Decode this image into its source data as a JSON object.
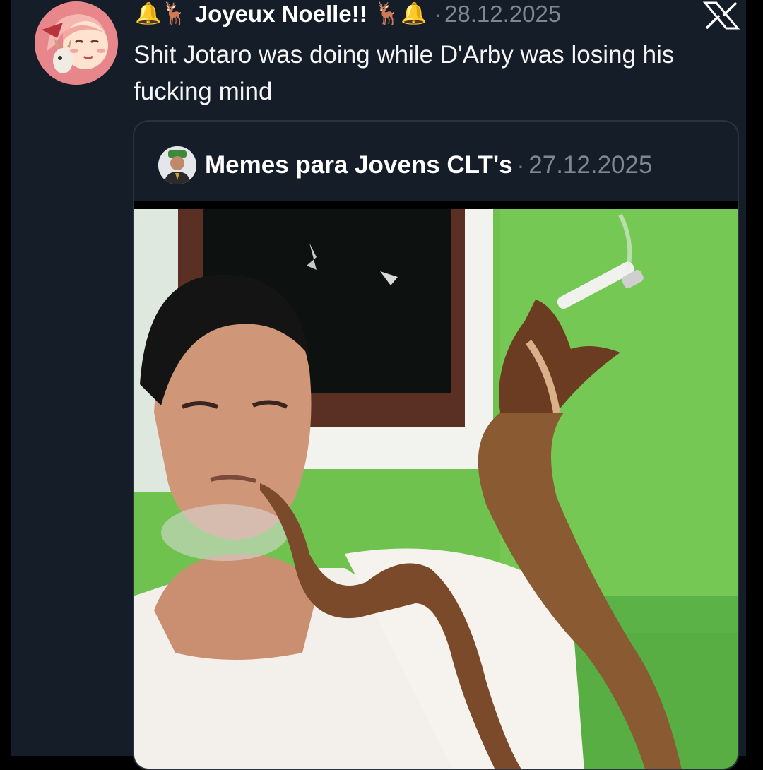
{
  "post": {
    "author": "Joyeux Noelle!!",
    "author_emoji_before": [
      "🔔",
      "🦌"
    ],
    "author_emoji_after": [
      "🦌",
      "🔔"
    ],
    "separator": "·",
    "date": "28.12.2025",
    "text": "Shit Jotaro was doing while D'Arby was losing his fucking mind",
    "platform_icon": "x-logo-icon"
  },
  "quoted_post": {
    "author": "Memes para Jovens CLT's",
    "separator": "·",
    "date": "27.12.2025",
    "media": "photo of a man smoking with a cobra holding a cigarette"
  },
  "colors": {
    "background": "#151d29",
    "text": "#f5f5f5",
    "muted": "#7e8790",
    "border": "#2a333f"
  }
}
